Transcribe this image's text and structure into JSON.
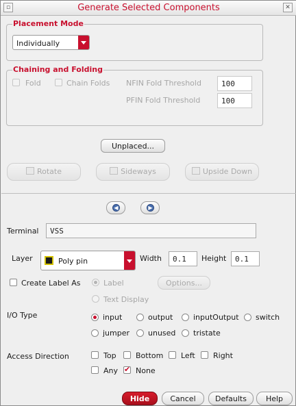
{
  "window": {
    "title": "Generate Selected Components"
  },
  "placement_mode": {
    "title": "Placement Mode",
    "selected": "Individually"
  },
  "chaining_folding": {
    "title": "Chaining and Folding",
    "fold_label": "Fold",
    "chain_folds_label": "Chain Folds",
    "nfin_label": "NFIN Fold Threshold",
    "nfin_value": "100",
    "pfin_label": "PFIN Fold Threshold",
    "pfin_value": "100"
  },
  "unplaced_button": "Unplaced...",
  "transform": {
    "rotate": "Rotate",
    "sideways": "Sideways",
    "upside_down": "Upside Down"
  },
  "terminal": {
    "label": "Terminal",
    "value": "VSS"
  },
  "layer": {
    "label": "Layer",
    "selected": "Poly pin",
    "width_label": "Width",
    "width_value": "0.1",
    "height_label": "Height",
    "height_value": "0.1"
  },
  "create_label": {
    "label": "Create Label As",
    "opt_label": "Label",
    "opt_text_display": "Text Display",
    "options_button": "Options..."
  },
  "io_type": {
    "label": "I/O Type",
    "options": [
      "input",
      "output",
      "inputOutput",
      "switch",
      "jumper",
      "unused",
      "tristate"
    ],
    "selected": "input"
  },
  "access_direction": {
    "label": "Access Direction",
    "options": [
      "Top",
      "Bottom",
      "Left",
      "Right",
      "Any",
      "None"
    ],
    "checked": [
      "None"
    ]
  },
  "footer": {
    "hide": "Hide",
    "cancel": "Cancel",
    "defaults": "Defaults",
    "help": "Help"
  },
  "colors": {
    "accent": "#c8102e",
    "layer_swatch_fill": "#1a1a1a",
    "layer_swatch_border": "#d4c300"
  }
}
